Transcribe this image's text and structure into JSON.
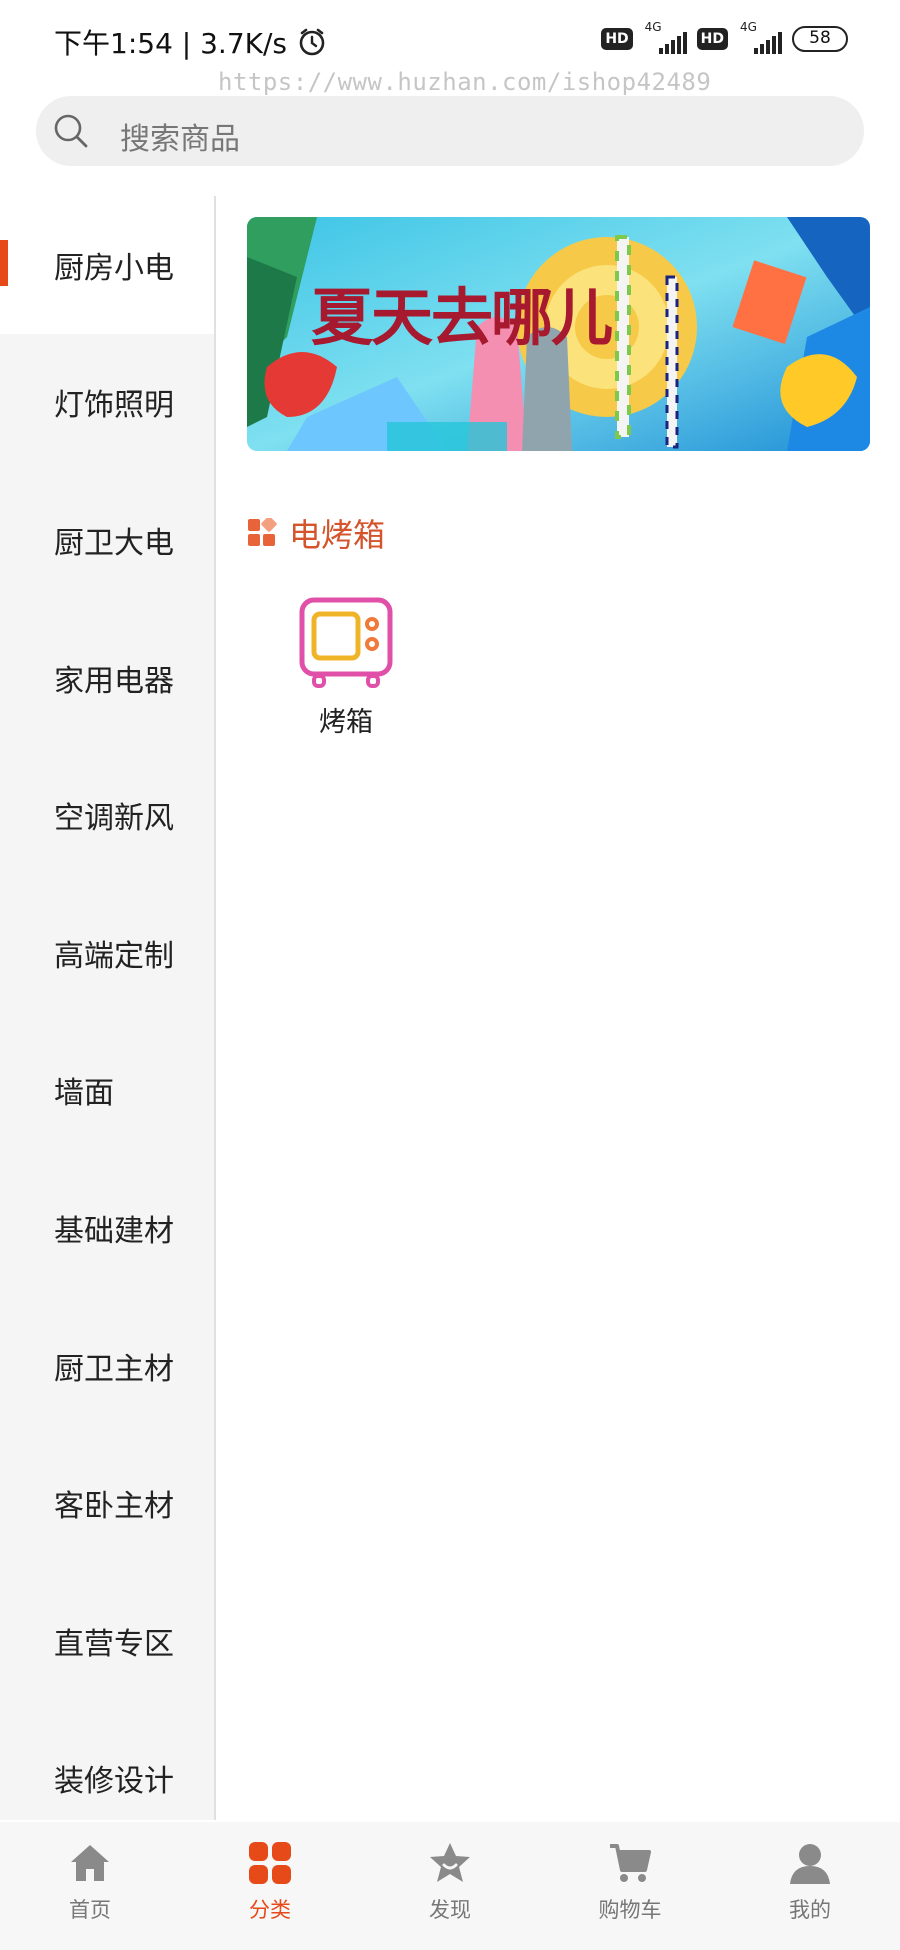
{
  "status_bar": {
    "time_speed": "下午1:54 | 3.7K/s",
    "hd": "HD",
    "network": "4G",
    "battery": "58"
  },
  "watermark": "https://www.huzhan.com/ishop42489",
  "search": {
    "placeholder": "搜索商品"
  },
  "sidebar": {
    "items": [
      {
        "label": "厨房小电",
        "active": true
      },
      {
        "label": "灯饰照明"
      },
      {
        "label": "厨卫大电"
      },
      {
        "label": "家用电器"
      },
      {
        "label": "空调新风"
      },
      {
        "label": "高端定制"
      },
      {
        "label": "墙面"
      },
      {
        "label": "基础建材"
      },
      {
        "label": "厨卫主材"
      },
      {
        "label": "客卧主材"
      },
      {
        "label": "直营专区"
      },
      {
        "label": "装修设计"
      }
    ]
  },
  "banner": {
    "text": "夏天去哪儿"
  },
  "section": {
    "title": "电烤箱",
    "products": [
      {
        "label": "烤箱",
        "icon": "oven-icon"
      }
    ]
  },
  "tab_bar": {
    "tabs": [
      {
        "label": "首页",
        "icon": "home-icon"
      },
      {
        "label": "分类",
        "icon": "category-icon",
        "active": true
      },
      {
        "label": "发现",
        "icon": "discover-icon"
      },
      {
        "label": "购物车",
        "icon": "cart-icon"
      },
      {
        "label": "我的",
        "icon": "profile-icon"
      }
    ]
  },
  "colors": {
    "accent": "#e64a19",
    "section_title": "#d4542c",
    "oven_outline": "#e04fa8",
    "oven_screen": "#f0b429"
  }
}
